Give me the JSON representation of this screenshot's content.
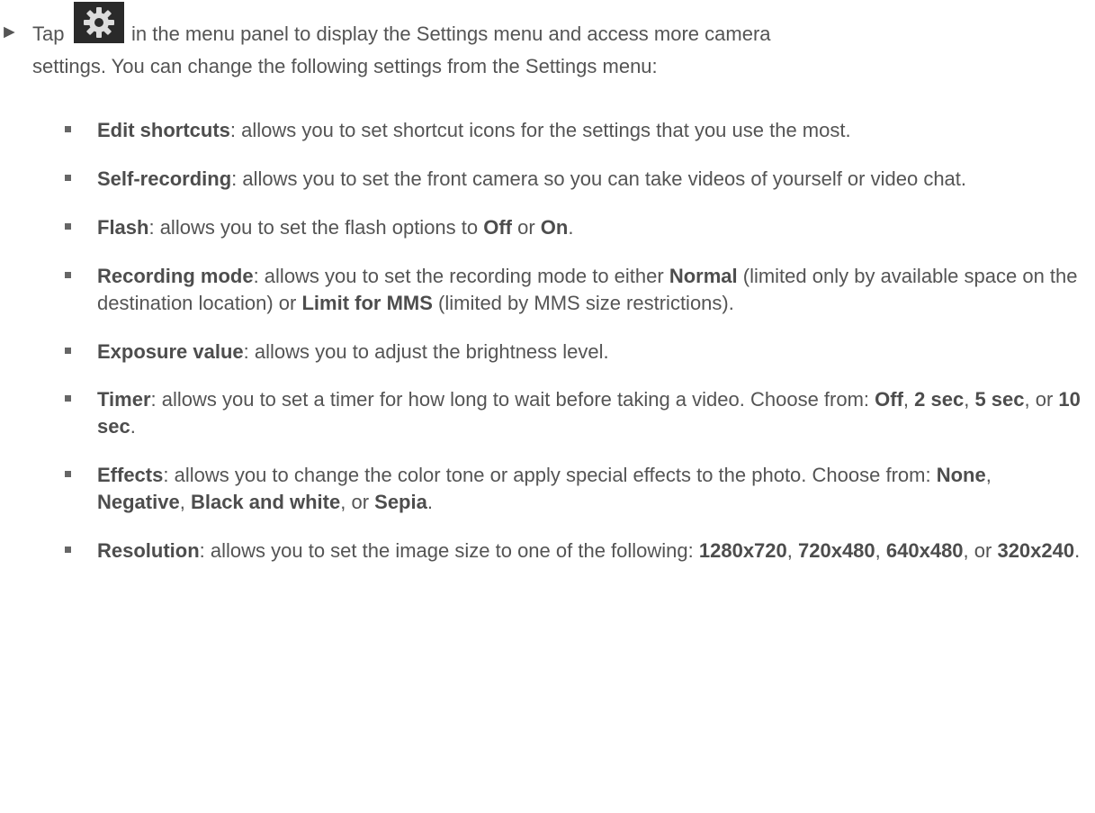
{
  "intro": {
    "tap": "Tap",
    "after_icon": "in the menu panel to display the Settings menu and access more camera",
    "line2": "settings. You can change the following settings from the Settings menu:",
    "icon": "gear-icon"
  },
  "items": [
    {
      "term": "Edit shortcuts",
      "desc": ": allows you to set shortcut icons for the settings that you use the most."
    },
    {
      "term": "Self-recording",
      "desc": ": allows you to set the front camera so you can take videos of yourself or video chat."
    },
    {
      "term": "Flash",
      "desc1": ": allows you to set the flash options to ",
      "opt1": "Off",
      "sep1": " or ",
      "opt2": "On",
      "end": "."
    },
    {
      "term": "Recording mode",
      "desc1": ": allows you to set the recording mode to either ",
      "opt1": "Normal",
      "desc2": " (limited only by available space on the destination location) or ",
      "opt2": "Limit for MMS",
      "desc3": " (limited by MMS size restrictions)."
    },
    {
      "term": "Exposure value",
      "desc": ": allows you to adjust the brightness level."
    },
    {
      "term": "Timer",
      "desc1": ": allows you to set a timer for how long to wait before taking a video. Choose from: ",
      "opt1": "Off",
      "sep1": ", ",
      "opt2": "2 sec",
      "sep2": ", ",
      "opt3": "5 sec",
      "sep3": ", or ",
      "opt4": "10 sec",
      "end": "."
    },
    {
      "term": "Effects",
      "desc1": ": allows you to change the color tone or apply special effects to the photo. Choose from: ",
      "opt1": "None",
      "sep1": ", ",
      "opt2": "Negative",
      "sep2": ", ",
      "opt3": "Black and white",
      "sep3": ", or ",
      "opt4": "Sepia",
      "end": "."
    },
    {
      "term": "Resolution",
      "desc1": ": allows you to set the image size to one of the following: ",
      "opt1": "1280x720",
      "sep1": ", ",
      "opt2": "720x480",
      "sep2": ", ",
      "opt3": "640x480",
      "sep3": ", or ",
      "opt4": "320x240",
      "end": "."
    }
  ]
}
